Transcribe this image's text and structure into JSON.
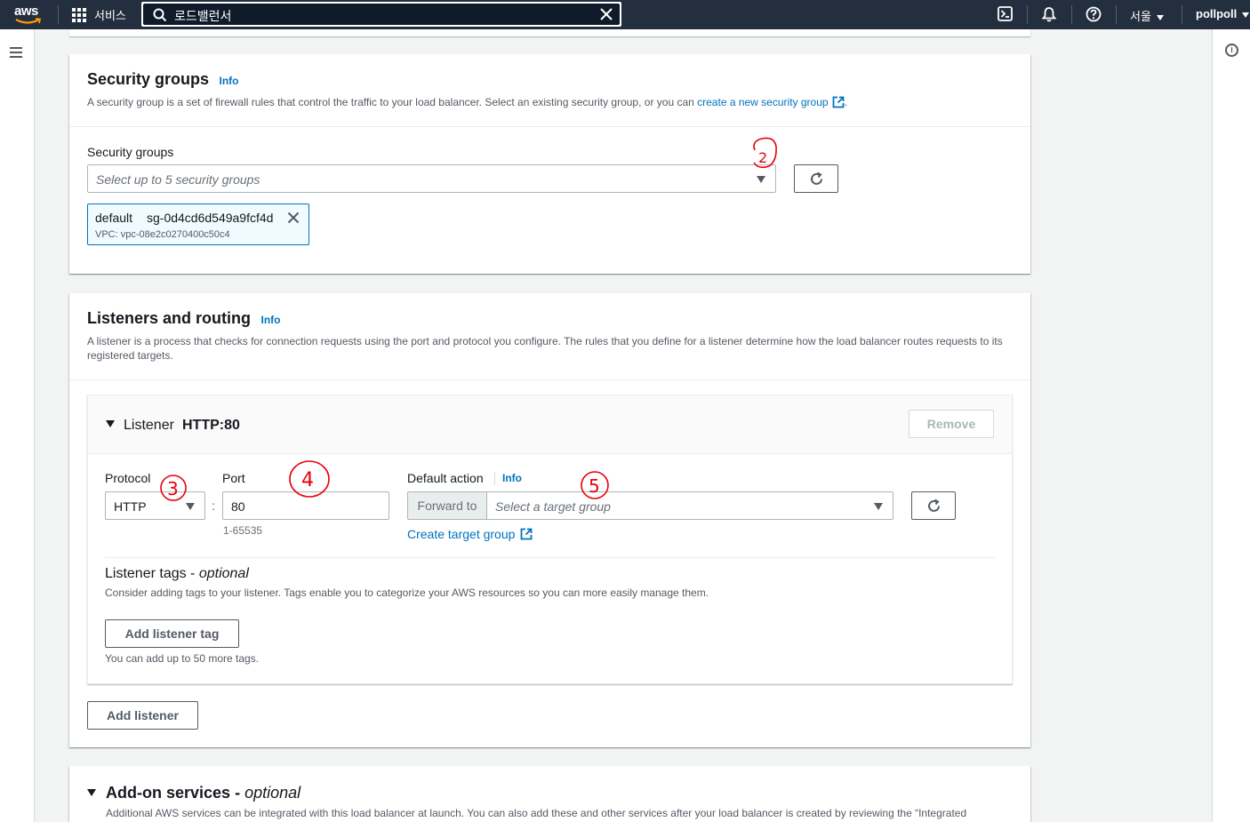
{
  "topnav": {
    "logo_text": "aws",
    "services_label": "서비스",
    "search_value": "로드밸런서",
    "region_label": "서울",
    "user_label": "pollpoll"
  },
  "security_groups": {
    "title": "Security groups",
    "info": "Info",
    "desc_prefix": "A security group is a set of firewall rules that control the traffic to your load balancer. Select an existing security group, or you can ",
    "desc_link": "create a new security group",
    "desc_suffix": ".",
    "field_label": "Security groups",
    "placeholder": "Select up to 5 security groups",
    "selected": {
      "name": "default",
      "id": "sg-0d4cd6d549a9fcf4d",
      "vpc": "VPC: vpc-08e2c0270400c50c4"
    }
  },
  "listeners": {
    "title": "Listeners and routing",
    "info": "Info",
    "desc": "A listener is a process that checks for connection requests using the port and protocol you configure. The rules that you define for a listener determine how the load balancer routes requests to its registered targets.",
    "listener": {
      "label": "Listener",
      "name": "HTTP:80",
      "remove_label": "Remove",
      "protocol_label": "Protocol",
      "protocol_value": "HTTP",
      "port_label": "Port",
      "port_value": "80",
      "port_hint": "1-65535",
      "default_action_label": "Default action",
      "default_action_info": "Info",
      "forward_label": "Forward to",
      "target_placeholder": "Select a target group",
      "create_target_link": "Create target group",
      "tags_title": "Listener tags",
      "tags_optional": "optional",
      "tags_desc": "Consider adding tags to your listener. Tags enable you to categorize your AWS resources so you can more easily manage them.",
      "add_tag_label": "Add listener tag",
      "tags_hint": "You can add up to 50 more tags."
    },
    "add_listener_label": "Add listener"
  },
  "addons": {
    "title": "Add-on services",
    "optional": "optional",
    "desc": "Additional AWS services can be integrated with this load balancer at launch. You can also add these and other services after your load balancer is created by reviewing the “Integrated"
  },
  "annotations": [
    "2",
    "3",
    "4",
    "5"
  ],
  "colors": {
    "nav_bg": "#232f3e",
    "link": "#0073bb",
    "annotation": "#e8000b"
  }
}
